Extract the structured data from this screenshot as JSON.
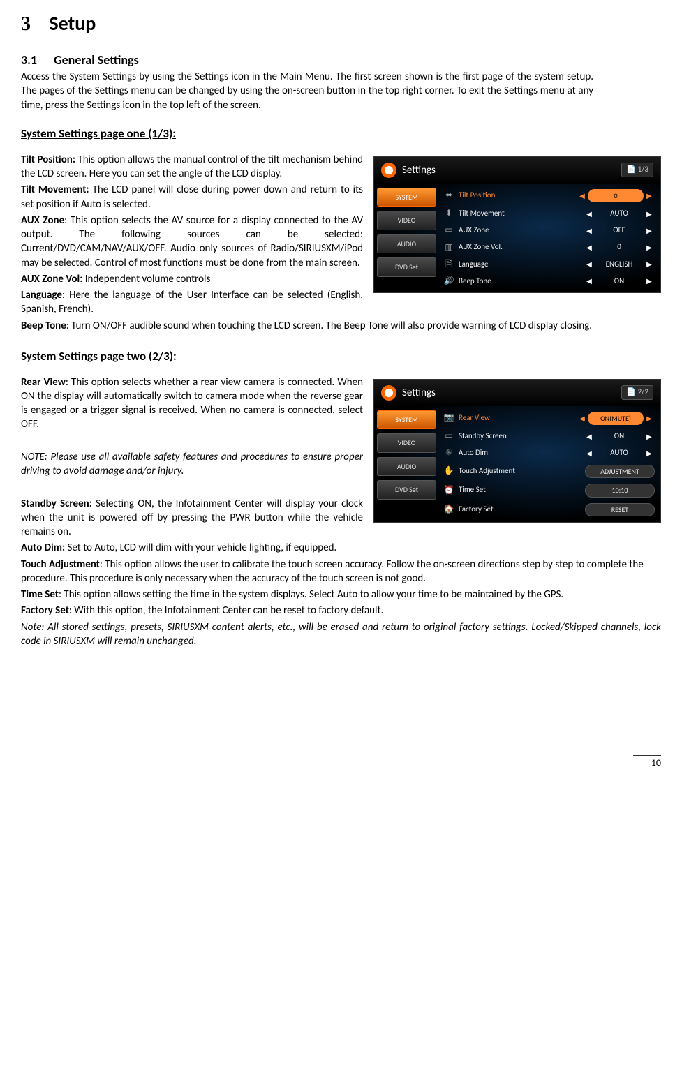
{
  "chapter": {
    "number": "3",
    "title": "Setup"
  },
  "sec31": {
    "number": "3.1",
    "title": "General Settings"
  },
  "intro": "Access the System Settings by using the Settings icon in the Main Menu. The first screen shown is the first page of the system setup. The pages of the Settings menu can be changed by using the on-screen button in the top right corner. To exit the Settings menu at any time, press the Settings icon in the top left of the screen.",
  "page1": {
    "heading": "System Settings page one (1/3):",
    "tilt_position": {
      "label": "Tilt Position:",
      "text": " This option allows the manual control of the tilt mechanism behind the LCD screen. Here you can set the angle of the LCD display."
    },
    "tilt_movement": {
      "label": "Tilt Movement:",
      "text": " The LCD panel will close during power down and return to its set position if Auto is selected."
    },
    "aux_zone": {
      "label": "AUX Zone",
      "text": ": This option selects the AV source for a display connected to the AV output. The following sources can be selected: Current/DVD/CAM/NAV/AUX/OFF. Audio only sources of Radio/SIRIUSXM/iPod may be selected. Control of most functions must be done from the main screen."
    },
    "aux_zone_vol": {
      "label": "AUX Zone Vol:",
      "text": " Independent volume controls"
    },
    "language": {
      "label": "Language",
      "text": ": Here the language of the User Interface can be selected (English, Spanish, French)."
    },
    "beep_tone": {
      "label": "Beep Tone",
      "text": ": Turn ON/OFF audible sound when touching the LCD screen. The Beep Tone will also provide warning of LCD display closing."
    },
    "screenshot": {
      "title": "Settings",
      "pager": "1/3",
      "tabs": [
        "SYSTEM",
        "VIDEO",
        "AUDIO",
        "DVD Set"
      ],
      "rows": [
        {
          "icon": "⬌",
          "label": "Tilt Position",
          "value": "0",
          "highlight": true,
          "pill": true
        },
        {
          "icon": "⬍",
          "label": "Tilt Movement",
          "value": "AUTO",
          "highlight": false,
          "pill": false
        },
        {
          "icon": "▭",
          "label": "AUX Zone",
          "value": "OFF",
          "highlight": false,
          "pill": false
        },
        {
          "icon": "▥",
          "label": "AUX Zone Vol.",
          "value": "0",
          "highlight": false,
          "pill": false
        },
        {
          "icon": "🗎",
          "label": "Language",
          "value": "ENGLISH",
          "highlight": false,
          "pill": false
        },
        {
          "icon": "🔊",
          "label": "Beep Tone",
          "value": "ON",
          "highlight": false,
          "pill": false
        }
      ]
    }
  },
  "page2": {
    "heading": "System Settings page two (2/3):",
    "rear_view": {
      "label": "Rear View",
      "text": ": This option selects whether a rear view camera is connected. When ON the display will automatically switch to camera mode when the reverse gear is engaged or a trigger signal is received. When no camera is connected, select OFF."
    },
    "note": "NOTE: Please use all available safety features and procedures to ensure proper driving to avoid damage and/or injury.",
    "standby": {
      "label": "Standby Screen:",
      "text": " Selecting ON, the Infotainment Center will display your clock when the unit is powered off by pressing the PWR button while the vehicle remains on."
    },
    "autodim": {
      "label": "Auto Dim:",
      "text": " Set to Auto, LCD will dim with your vehicle lighting, if equipped."
    },
    "touch": {
      "label": "Touch Adjustment",
      "text": ": This option allows the user to calibrate the touch screen accuracy. Follow the on-screen directions step by step to complete the procedure. This procedure is only necessary when the accuracy of the touch screen is not good."
    },
    "time": {
      "label": "Time Set",
      "text": ": This option allows setting the time in the system displays. Select Auto to allow your time to be maintained by the GPS."
    },
    "factory": {
      "label": "Factory Set",
      "text": ": With this option, the Infotainment Center can be reset to factory default."
    },
    "factory_note": "Note: All stored settings, presets, SIRIUSXM content alerts, etc., will be erased and return to original factory settings. Locked/Skipped channels, lock code in SIRIUSXM will remain unchanged.",
    "screenshot": {
      "title": "Settings",
      "pager": "2/2",
      "tabs": [
        "SYSTEM",
        "VIDEO",
        "AUDIO",
        "DVD Set"
      ],
      "rows": [
        {
          "icon": "📷",
          "label": "Rear View",
          "value": "ON(MUTE)",
          "highlight": true,
          "pill": true,
          "arrows": true
        },
        {
          "icon": "▭",
          "label": "Standby Screen",
          "value": "ON",
          "highlight": false,
          "pill": false,
          "arrows": true
        },
        {
          "icon": "☀",
          "label": "Auto Dim",
          "value": "AUTO",
          "highlight": false,
          "pill": false,
          "arrows": true
        },
        {
          "icon": "✋",
          "label": "Touch Adjustment",
          "value": "ADJUSTMENT",
          "highlight": false,
          "pill": true,
          "arrows": false
        },
        {
          "icon": "⏰",
          "label": "Time Set",
          "value": "10:10",
          "highlight": false,
          "pill": true,
          "arrows": false
        },
        {
          "icon": "🏠",
          "label": "Factory Set",
          "value": "RESET",
          "highlight": false,
          "pill": true,
          "arrows": false
        }
      ]
    }
  },
  "arrows": {
    "left": "◀",
    "right": "▶",
    "pageicon": "📄"
  },
  "page_number": "10"
}
